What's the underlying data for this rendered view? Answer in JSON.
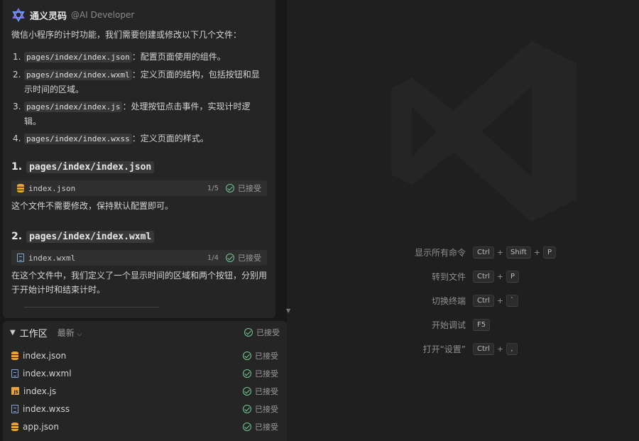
{
  "chat": {
    "author": "通义灵码",
    "handle": "@AI Developer",
    "intro": "微信小程序的计时功能，我们需要创建或修改以下几个文件：",
    "files": [
      {
        "num": "1.",
        "path": "pages/index/index.json",
        "desc": "：配置页面使用的组件。"
      },
      {
        "num": "2.",
        "path": "pages/index/index.wxml",
        "desc": "：定义页面的结构，包括按钮和显示时间的区域。"
      },
      {
        "num": "3.",
        "path": "pages/index/index.js",
        "desc": "：处理按钮点击事件，实现计时逻辑。"
      },
      {
        "num": "4.",
        "path": "pages/index/index.wxss",
        "desc": "：定义页面的样式。"
      }
    ],
    "section1": {
      "num": "1.",
      "path": "pages/index/index.json",
      "card": {
        "name": "index.json",
        "count": "1/5",
        "status": "已接受"
      },
      "text": "这个文件不需要修改，保持默认配置即可。"
    },
    "section2": {
      "num": "2.",
      "path": "pages/index/index.wxml",
      "card": {
        "name": "index.wxml",
        "count": "1/4",
        "status": "已接受"
      },
      "text": "在这个文件中，我们定义了一个显示时间的区域和两个按钮，分别用于开始计时和结束计时。"
    }
  },
  "workspace": {
    "title": "工作区",
    "recent": "最新",
    "status": "已接受",
    "files": [
      {
        "name": "index.json",
        "icon": "database-icon",
        "status": "已接受"
      },
      {
        "name": "index.wxml",
        "icon": "document-icon",
        "status": "已接受"
      },
      {
        "name": "index.js",
        "icon": "js-file-icon",
        "status": "已接受"
      },
      {
        "name": "index.wxss",
        "icon": "document-icon",
        "status": "已接受"
      },
      {
        "name": "app.json",
        "icon": "database-icon",
        "status": "已接受"
      }
    ]
  },
  "editor": {
    "shortcuts": [
      {
        "label": "显示所有命令",
        "keys": [
          "Ctrl",
          "Shift",
          "P"
        ]
      },
      {
        "label": "转到文件",
        "keys": [
          "Ctrl",
          "P"
        ]
      },
      {
        "label": "切换终端",
        "keys": [
          "Ctrl",
          "`"
        ]
      },
      {
        "label": "开始调试",
        "keys": [
          "F5"
        ]
      },
      {
        "label": "打开“设置”",
        "keys": [
          "Ctrl",
          ","
        ]
      }
    ]
  },
  "colors": {
    "accepted": "#73c991",
    "json_icon": "#e8a33d",
    "doc_icon": "#7fa7d8"
  }
}
